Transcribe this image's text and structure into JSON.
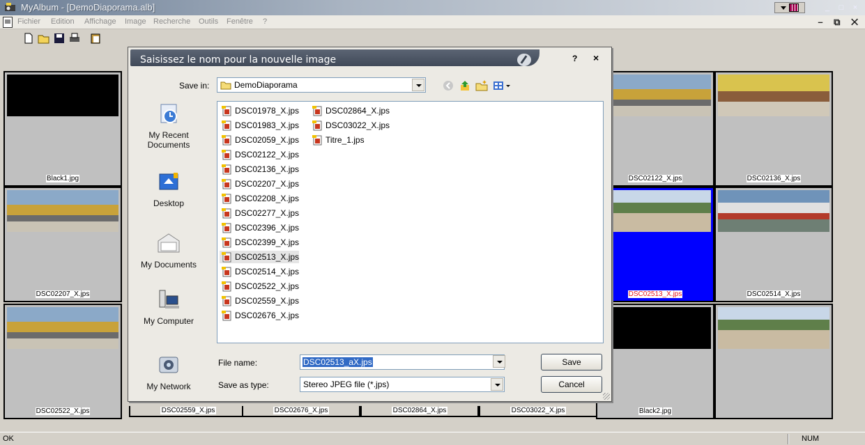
{
  "window": {
    "title": "MyAlbum - [DemoDiaporama.alb]"
  },
  "menu": {
    "items": [
      "Fichier",
      "Edition",
      "Affichage",
      "Image",
      "Recherche",
      "Outils",
      "Fenêtre",
      "?"
    ],
    "mdi_controls": "– ⧉ ✕"
  },
  "thumbnails": [
    {
      "caption": "Black1.jpg",
      "image": "black"
    },
    {
      "caption": "DSC02122_X.jps",
      "image": "bus"
    },
    {
      "caption": "DSC02136_X.jps",
      "image": "stall"
    },
    {
      "caption": "DSC02207_X.jps",
      "image": "bus"
    },
    {
      "caption": "DSC02513_X.jps",
      "image": "land",
      "selected": true
    },
    {
      "caption": "DSC02514_X.jps",
      "image": "bus2"
    },
    {
      "caption": "DSC02522_X.jps",
      "image": "bus"
    },
    {
      "caption": "Black2.jpg",
      "image": "black"
    },
    {
      "caption": "",
      "image": "land"
    }
  ],
  "bottom_captions": [
    "DSC02559_X.jps",
    "DSC02676_X.jps",
    "DSC02864_X.jps",
    "DSC03022_X.jps"
  ],
  "status": {
    "text": "OK",
    "num": "NUM"
  },
  "dialog": {
    "title": "Saisissez le nom pour la nouvelle image",
    "help": "?",
    "close": "×",
    "save_in_label": "Save in:",
    "save_in_value": "DemoDiaporama",
    "places": [
      {
        "label": "My Recent Documents",
        "icon": "recent-documents-icon"
      },
      {
        "label": "Desktop",
        "icon": "desktop-icon"
      },
      {
        "label": "My Documents",
        "icon": "my-documents-icon"
      },
      {
        "label": "My Computer",
        "icon": "my-computer-icon"
      },
      {
        "label": "My Network",
        "icon": "my-network-icon"
      }
    ],
    "files_col1": [
      "DSC01978_X.jps",
      "DSC01983_X.jps",
      "DSC02059_X.jps",
      "DSC02122_X.jps",
      "DSC02136_X.jps",
      "DSC02207_X.jps",
      "DSC02208_X.jps",
      "DSC02277_X.jps",
      "DSC02396_X.jps",
      "DSC02399_X.jps",
      "DSC02513_X.jps",
      "DSC02514_X.jps",
      "DSC02522_X.jps",
      "DSC02559_X.jps",
      "DSC02676_X.jps"
    ],
    "files_col2": [
      "DSC02864_X.jps",
      "DSC03022_X.jps",
      "Titre_1.jps"
    ],
    "selected_file": "DSC02513_X.jps",
    "file_name_label": "File name:",
    "file_name_value": "DSC02513_aX.jps",
    "save_as_type_label": "Save as type:",
    "save_as_type_value": "Stereo JPEG file (*.jps)",
    "save_button": "Save",
    "cancel_button": "Cancel"
  }
}
